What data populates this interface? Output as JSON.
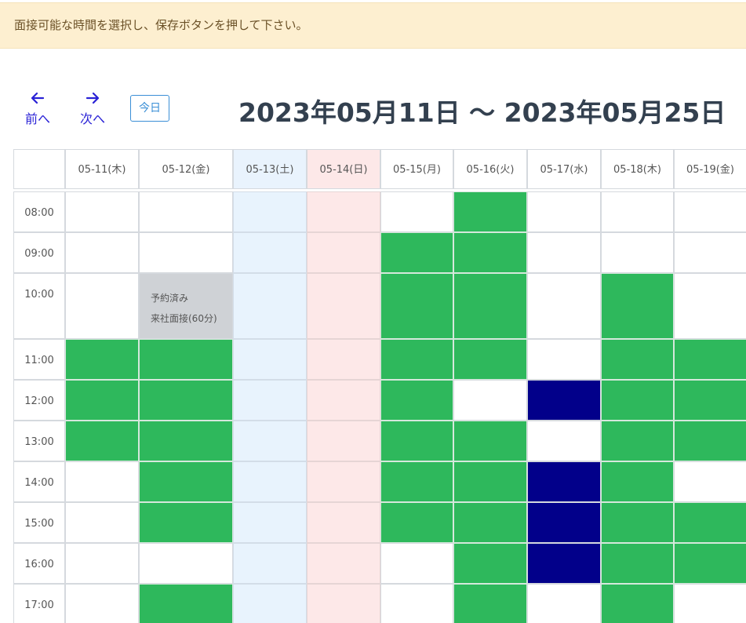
{
  "alert": {
    "message": "面接可能な時間を選択し、保存ボタンを押して下さい。"
  },
  "toolbar": {
    "prev_label": "前へ",
    "next_label": "次へ",
    "today_label": "今日",
    "range_title": "2023年05月11日 ～ 2023年05月25日"
  },
  "calendar": {
    "days": [
      {
        "label": "05-11(木)",
        "type": "weekday"
      },
      {
        "label": "05-12(金)",
        "type": "weekday"
      },
      {
        "label": "05-13(土)",
        "type": "sat"
      },
      {
        "label": "05-14(日)",
        "type": "sun"
      },
      {
        "label": "05-15(月)",
        "type": "weekday"
      },
      {
        "label": "05-16(火)",
        "type": "weekday"
      },
      {
        "label": "05-17(水)",
        "type": "weekday"
      },
      {
        "label": "05-18(木)",
        "type": "weekday"
      },
      {
        "label": "05-19(金)",
        "type": "weekday"
      }
    ],
    "times": [
      "08:00",
      "09:00",
      "10:00",
      "11:00",
      "12:00",
      "13:00",
      "14:00",
      "15:00",
      "16:00",
      "17:00"
    ],
    "legend_colors": {
      "available": "#2eb85c",
      "selected": "#02008a",
      "booked": "#cfd2d6",
      "saturday": "#e8f3fd",
      "sunday": "#fde8e8"
    },
    "booked_text": {
      "status": "予約済み",
      "detail": "来社面接(60分)"
    },
    "slots": [
      [
        "free",
        "free",
        "sat",
        "sun",
        "free",
        "avail",
        "free",
        "free",
        "free"
      ],
      [
        "free",
        "free",
        "sat",
        "sun",
        "avail",
        "avail",
        "free",
        "free",
        "free"
      ],
      [
        "free",
        "booked",
        "sat",
        "sun",
        "avail",
        "avail",
        "free",
        "avail",
        "free"
      ],
      [
        "avail",
        "avail",
        "sat",
        "sun",
        "avail",
        "avail",
        "free",
        "avail",
        "avail"
      ],
      [
        "avail",
        "avail",
        "sat",
        "sun",
        "avail",
        "free",
        "reserved",
        "avail",
        "avail"
      ],
      [
        "avail",
        "avail",
        "sat",
        "sun",
        "avail",
        "avail",
        "free",
        "avail",
        "avail"
      ],
      [
        "free",
        "avail",
        "sat",
        "sun",
        "avail",
        "avail",
        "reserved",
        "avail",
        "free"
      ],
      [
        "free",
        "avail",
        "sat",
        "sun",
        "avail",
        "avail",
        "reserved",
        "avail",
        "avail"
      ],
      [
        "free",
        "free",
        "sat",
        "sun",
        "free",
        "avail",
        "reserved",
        "avail",
        "avail"
      ],
      [
        "free",
        "avail",
        "sat",
        "sun",
        "free",
        "avail",
        "free",
        "avail",
        "free"
      ]
    ]
  }
}
